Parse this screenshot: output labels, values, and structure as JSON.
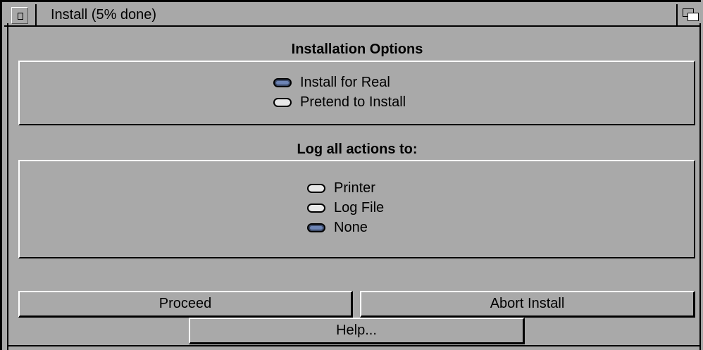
{
  "window": {
    "title": "Install (5% done)",
    "progress_percent": 5,
    "close_gadget_icon": "close-gadget-icon",
    "depth_gadget_icon": "depth-arrange-icon"
  },
  "installation_options": {
    "heading": "Installation Options",
    "options": [
      {
        "label": "Install for Real",
        "selected": true
      },
      {
        "label": "Pretend to Install",
        "selected": false
      }
    ]
  },
  "log_options": {
    "heading": "Log all actions to:",
    "options": [
      {
        "label": "Printer",
        "selected": false
      },
      {
        "label": "Log File",
        "selected": false
      },
      {
        "label": "None",
        "selected": true
      }
    ]
  },
  "buttons": {
    "proceed": "Proceed",
    "abort": "Abort Install",
    "help": "Help..."
  },
  "colors": {
    "background": "#a9a9a9",
    "radio_selected": "#6d84b5",
    "radio_unselected": "#e8e8e8"
  }
}
